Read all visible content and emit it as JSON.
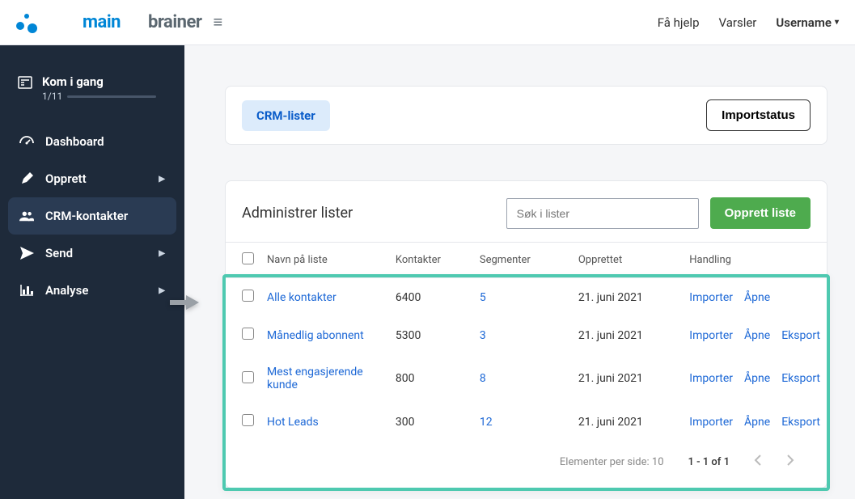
{
  "brand": {
    "main": "main",
    "brainer": "brainer"
  },
  "topnav": {
    "help": "Få hjelp",
    "alerts": "Varsler",
    "username": "Username"
  },
  "sidebar": {
    "progress": {
      "title": "Kom i gang",
      "counter": "1/11",
      "percent": 9
    },
    "items": [
      {
        "label": "Dashboard",
        "icon": "dashboard-icon",
        "chevron": false
      },
      {
        "label": "Opprett",
        "icon": "pencil-icon",
        "chevron": true
      },
      {
        "label": "CRM-kontakter",
        "icon": "users-icon",
        "chevron": false,
        "active": true
      },
      {
        "label": "Send",
        "icon": "send-icon",
        "chevron": true
      },
      {
        "label": "Analyse",
        "icon": "chart-icon",
        "chevron": true
      }
    ]
  },
  "tabs": {
    "crm_lists": "CRM-lister",
    "import_status": "Importstatus"
  },
  "lists": {
    "title": "Administrer lister",
    "search_placeholder": "Søk i lister",
    "create_label": "Opprett liste",
    "columns": {
      "name": "Navn på liste",
      "contacts": "Kontakter",
      "segments": "Segmenter",
      "created": "Opprettet",
      "actions": "Handling"
    },
    "actions": {
      "import": "Importer",
      "open": "Åpne",
      "export": "Eksport"
    },
    "rows": [
      {
        "name": "Alle kontakter",
        "contacts": "6400",
        "segments": "5",
        "created": "21. juni 2021",
        "has_export": false
      },
      {
        "name": "Månedlig abonnent",
        "contacts": "5300",
        "segments": "3",
        "created": "21. juni 2021",
        "has_export": true
      },
      {
        "name": "Mest engasjerende kunde",
        "contacts": "800",
        "segments": "8",
        "created": "21. juni 2021",
        "has_export": true
      },
      {
        "name": "Hot Leads",
        "contacts": "300",
        "segments": "12",
        "created": "21. juni 2021",
        "has_export": true
      }
    ]
  },
  "pager": {
    "per_page_label": "Elementer per side: 10",
    "range": "1 - 1 of 1"
  }
}
